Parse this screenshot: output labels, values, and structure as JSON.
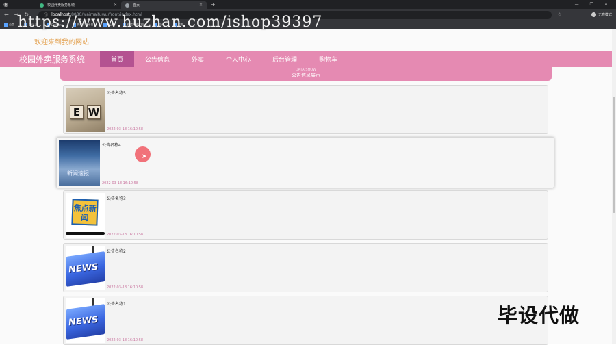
{
  "browser": {
    "tabs": [
      {
        "label": "校园外卖服务系统",
        "active": false
      },
      {
        "label": "首页",
        "active": true
      }
    ],
    "url_host": "localhost",
    "url_path": ":8080/waimaifuwu/front/index.html",
    "incognito_label": "无痕模式",
    "bookmarks": [
      "百度",
      "Bilibili",
      "Element",
      "微信公众平台",
      "Vue",
      "微信开放文档",
      "登录",
      "哔哩"
    ]
  },
  "watermark": {
    "url": "https://www.huzhan.com/ishop39397",
    "corner": "毕设代做"
  },
  "site": {
    "welcome": "欢迎来到我的网站",
    "brand": "校园外卖服务系统",
    "nav": [
      "首页",
      "公告信息",
      "外卖",
      "个人中心",
      "后台管理",
      "购物车"
    ],
    "active_nav": "首页",
    "section_en": "DATA SHOW",
    "section_cn": "公告信息展示"
  },
  "notices": [
    {
      "title": "公告名称5",
      "time": "2022-03-18 16:10:58",
      "image": "ew-tiles"
    },
    {
      "title": "公告名称4",
      "time": "2022-03-18 16:10:58",
      "image": "sky-news",
      "image_text": "新闻速报"
    },
    {
      "title": "公告名称3",
      "time": "2022-03-18 16:10:58",
      "image": "hot-news-badge",
      "image_text": "焦点新闻"
    },
    {
      "title": "公告名称2",
      "time": "2022-03-18 16:10:58",
      "image": "news-blue",
      "image_text": "NEWS"
    },
    {
      "title": "公告名称1",
      "time": "2022-03-18 16:10:58",
      "image": "news-blue",
      "image_text": "NEWS"
    }
  ],
  "thumb_tiles": [
    "E",
    "W"
  ]
}
